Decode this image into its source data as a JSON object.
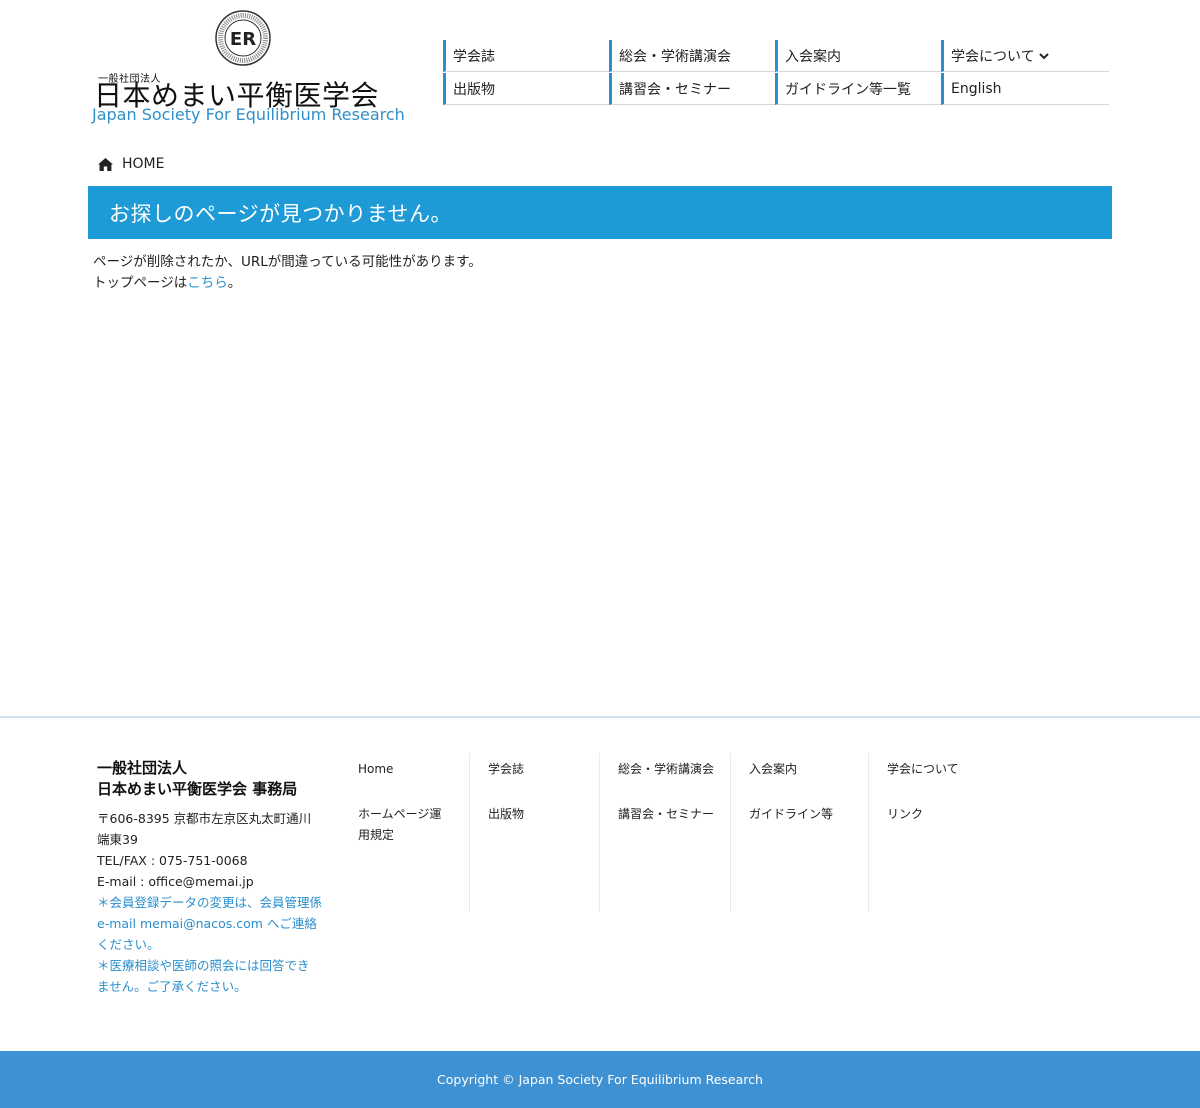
{
  "header": {
    "logo": {
      "emblem_text": "ER",
      "emblem_ring_text": "JAPAN SOCIETY FOR EQUILIBRIUM RESEARCH",
      "prefix": "一般社団法人",
      "name": "日本めまい平衡医学会",
      "english": "Japan Society For Equilibrium Research"
    },
    "nav": [
      {
        "label": "学会誌"
      },
      {
        "label": "総会・学術講演会"
      },
      {
        "label": "入会案内"
      },
      {
        "label": "学会について",
        "icon": "chevron-down-icon"
      },
      {
        "label": "出版物"
      },
      {
        "label": "講習会・セミナー"
      },
      {
        "label": "ガイドライン等一覧"
      },
      {
        "label": "English"
      }
    ]
  },
  "breadcrumb": {
    "icon": "home-icon",
    "label": "HOME"
  },
  "page": {
    "title": "お探しのページが見つかりません。",
    "line1": "ページが削除されたか、URLが間違っている可能性があります。",
    "line2_prefix": "トップページは",
    "line2_link": "こちら",
    "line2_suffix": "。"
  },
  "footer": {
    "org_line1": "一般社団法人",
    "org_line2": "日本めまい平衡医学会 事務局",
    "address": "〒606-8395 京都市左京区丸太町通川端東39",
    "tel": "TEL/FAX : 075-751-0068",
    "email": "E-mail : office@memai.jp",
    "note1": "＊会員登録データの変更は、会員管理係 e-mail  memai@nacos.com へご連絡ください。",
    "note2": "＊医療相談や医師の照会には回答できません。ご了承ください。",
    "columns": [
      [
        "Home",
        "ホームページ運用規定"
      ],
      [
        "学会誌",
        "出版物"
      ],
      [
        "総会・学術講演会",
        "講習会・セミナー"
      ],
      [
        "入会案内",
        "ガイドライン等"
      ],
      [
        "学会について",
        "リンク"
      ]
    ],
    "copyright": "Copyright © Japan Society For Equilibrium Research"
  },
  "colors": {
    "accent": "#1e9ad6",
    "nav_border": "#2a8fce",
    "link": "#2a8fce",
    "copyright_bg": "#3e91d3"
  }
}
